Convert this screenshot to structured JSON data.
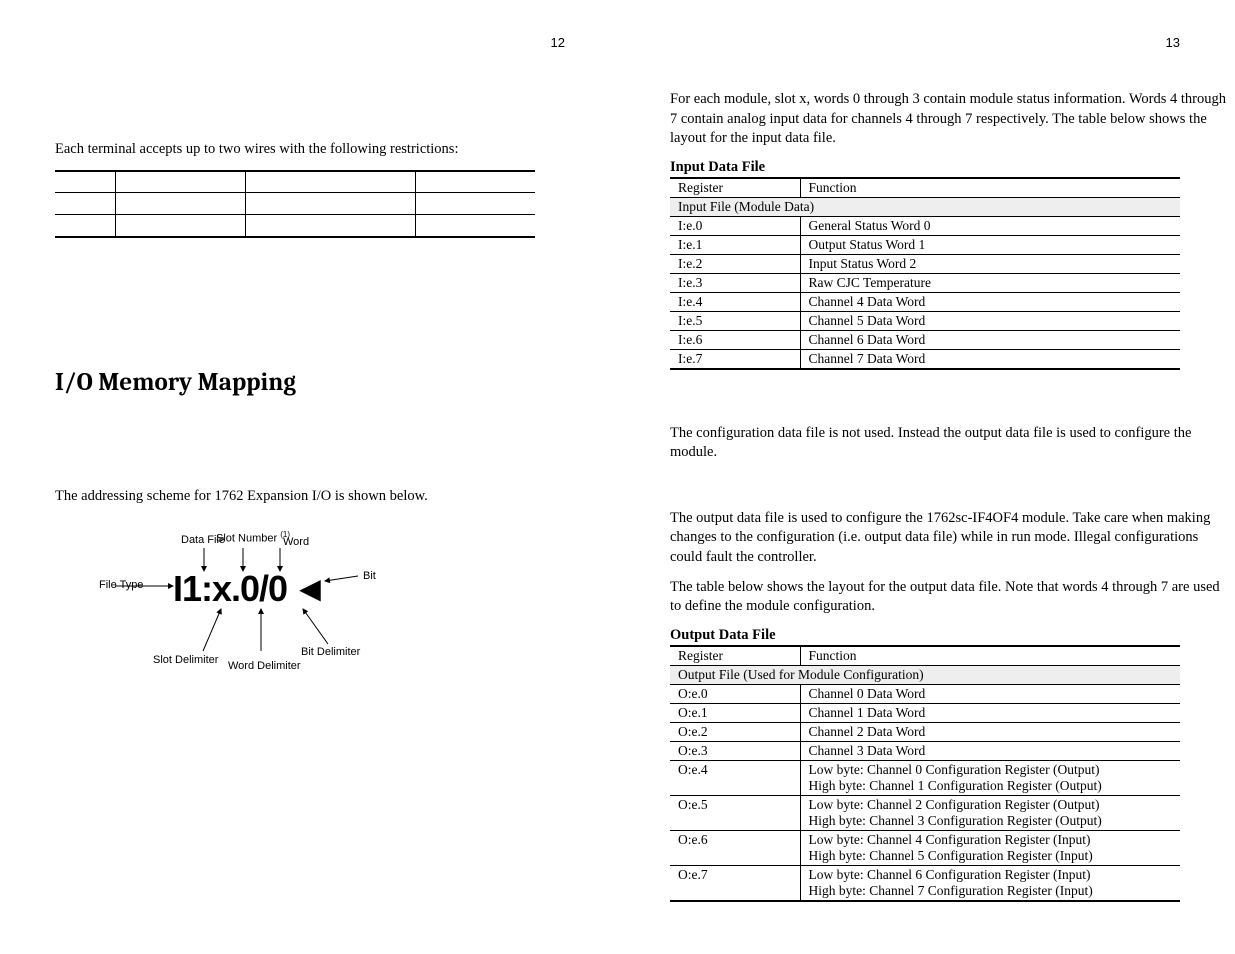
{
  "pages": {
    "left_num": "12",
    "right_num": "13"
  },
  "left": {
    "intro_line": "Each terminal accepts up to two wires with the following restrictions:",
    "section_heading": "I/O Memory Mapping",
    "addressing_line": "The addressing scheme for 1762 Expansion I/O is shown below.",
    "diagram": {
      "main": "I1:x.0/0",
      "file_type": "File Type",
      "data_file": "Data File",
      "slot_number": "Slot Number",
      "sup": "(1)",
      "word": "Word",
      "bit": "Bit",
      "slot_delim": "Slot Delimiter",
      "word_delim": "Word Delimiter",
      "bit_delim": "Bit Delimiter"
    }
  },
  "right": {
    "para1": "For each module, slot x, words 0 through 3 contain module status information. Words 4 through 7 contain analog input data for channels 4 through 7 respectively. The table below shows the layout for the input data file.",
    "input_title": "Input Data File",
    "hdr_register": "Register",
    "hdr_function": "Function",
    "input_span": "Input File  (Module Data)",
    "input_rows": [
      {
        "r": "I:e.0",
        "f": "General Status Word 0"
      },
      {
        "r": "I:e.1",
        "f": "Output Status Word 1"
      },
      {
        "r": "I:e.2",
        "f": "Input Status Word 2"
      },
      {
        "r": "I:e.3",
        "f": "Raw CJC Temperature"
      },
      {
        "r": "I:e.4",
        "f": "Channel 4 Data Word"
      },
      {
        "r": "I:e.5",
        "f": "Channel 5 Data Word"
      },
      {
        "r": "I:e.6",
        "f": "Channel 6 Data Word"
      },
      {
        "r": "I:e.7",
        "f": "Channel 7 Data Word"
      }
    ],
    "para2": "The configuration data file is not used.  Instead the output data file is used to configure the module.",
    "para3": "The output data file is used to configure the 1762sc-IF4OF4 module.  Take care when making changes to the configuration (i.e. output data file) while in run mode.  Illegal configurations could fault the controller.",
    "para4": "The table below shows the layout for the output data file.  Note that words 4 through 7 are used to define the module configuration.",
    "output_title": "Output Data File",
    "output_span": "Output File (Used for Module Configuration)",
    "output_rows": [
      {
        "r": "O:e.0",
        "f": [
          "Channel 0 Data Word"
        ]
      },
      {
        "r": "O:e.1",
        "f": [
          "Channel 1 Data Word"
        ]
      },
      {
        "r": "O:e.2",
        "f": [
          "Channel 2 Data Word"
        ]
      },
      {
        "r": "O:e.3",
        "f": [
          "Channel 3 Data Word"
        ]
      },
      {
        "r": "O:e.4",
        "f": [
          "Low byte: Channel 0 Configuration Register (Output)",
          "High byte: Channel 1 Configuration Register (Output)"
        ]
      },
      {
        "r": "O:e.5",
        "f": [
          "Low byte: Channel 2 Configuration Register (Output)",
          "High byte: Channel 3 Configuration Register (Output)"
        ]
      },
      {
        "r": "O:e.6",
        "f": [
          "Low byte: Channel 4 Configuration Register (Input)",
          "High byte: Channel 5 Configuration Register (Input)"
        ]
      },
      {
        "r": "O:e.7",
        "f": [
          "Low byte: Channel 6 Configuration Register (Input)",
          "High byte: Channel 7 Configuration Register (Input)"
        ]
      }
    ]
  }
}
